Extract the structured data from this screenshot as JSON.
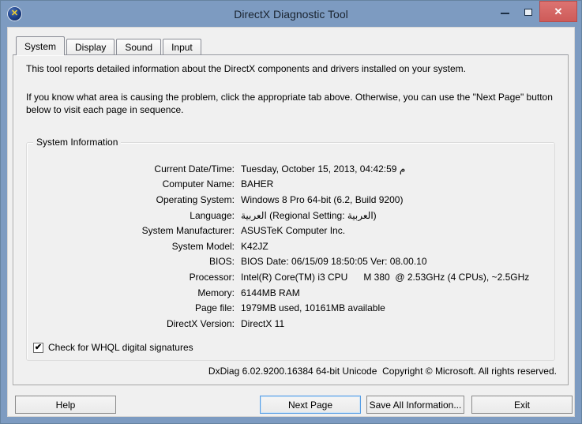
{
  "window": {
    "title": "DirectX Diagnostic Tool",
    "controls": {
      "close_glyph": "✕"
    },
    "app_icon_glyph": "✕"
  },
  "tabs": [
    {
      "label": "System",
      "active": true
    },
    {
      "label": "Display",
      "active": false
    },
    {
      "label": "Sound",
      "active": false
    },
    {
      "label": "Input",
      "active": false
    }
  ],
  "intro": {
    "line1": "This tool reports detailed information about the DirectX components and drivers installed on your system.",
    "line2": "If you know what area is causing the problem, click the appropriate tab above.  Otherwise, you can use the \"Next Page\" button below to visit each page in sequence."
  },
  "system_information": {
    "title": "System Information",
    "rows": [
      {
        "label": "Current Date/Time:",
        "value": "Tuesday, October 15, 2013, 04:42:59 م"
      },
      {
        "label": "Computer Name:",
        "value": "BAHER"
      },
      {
        "label": "Operating System:",
        "value": "Windows 8 Pro 64-bit (6.2, Build 9200)"
      },
      {
        "label": "Language:",
        "value": "العربية (Regional Setting: العربية)"
      },
      {
        "label": "System Manufacturer:",
        "value": "ASUSTeK Computer Inc."
      },
      {
        "label": "System Model:",
        "value": "K42JZ"
      },
      {
        "label": "BIOS:",
        "value": "BIOS Date: 06/15/09 18:50:05 Ver: 08.00.10"
      },
      {
        "label": "Processor:",
        "value": "Intel(R) Core(TM) i3 CPU      M 380  @ 2.53GHz (4 CPUs), ~2.5GHz"
      },
      {
        "label": "Memory:",
        "value": "6144MB RAM"
      },
      {
        "label": "Page file:",
        "value": "1979MB used, 10161MB available"
      },
      {
        "label": "DirectX Version:",
        "value": "DirectX 11"
      }
    ]
  },
  "whql_checkbox": {
    "checked": true,
    "glyph": "✔",
    "label": "Check for WHQL digital signatures"
  },
  "footer": {
    "version_line": "DxDiag 6.02.9200.16384 64-bit Unicode  Copyright © Microsoft. All rights reserved."
  },
  "buttons": {
    "help": "Help",
    "next_page": "Next Page",
    "save_all": "Save All Information...",
    "exit": "Exit"
  },
  "colors": {
    "titlebar": "#7d9bc1",
    "close_button": "#cd5a58",
    "dialog_bg": "#f0f0f0",
    "focus_border": "#569de5"
  }
}
